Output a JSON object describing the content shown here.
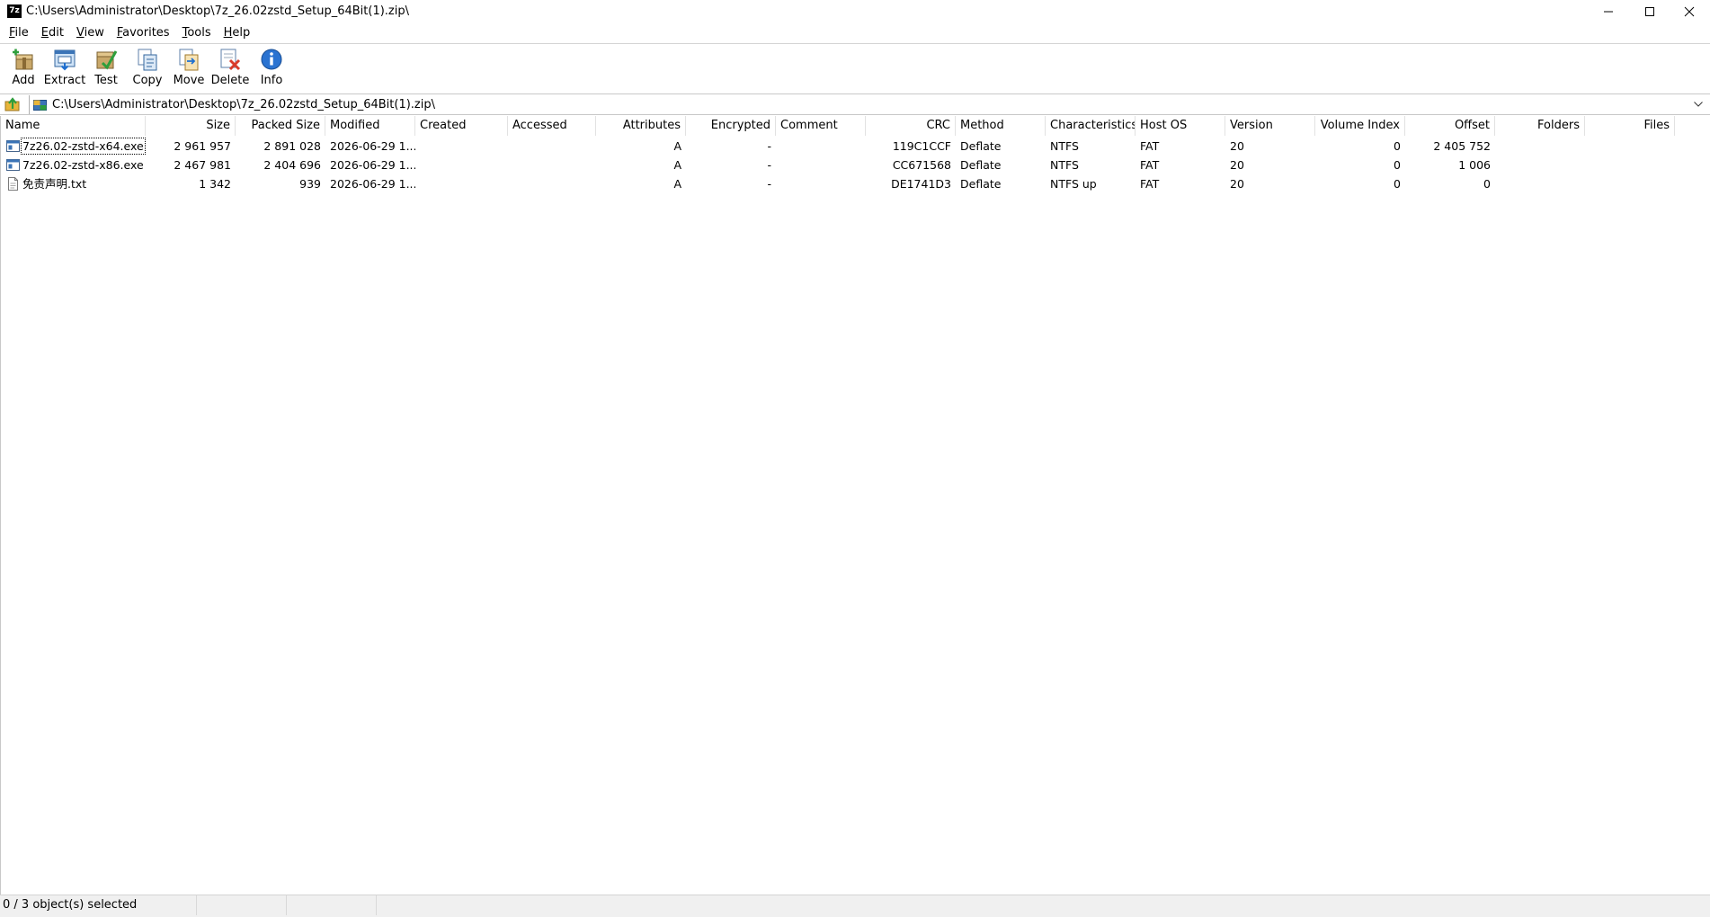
{
  "window": {
    "app_icon_text": "7z",
    "title": "C:\\Users\\Administrator\\Desktop\\7z_26.02zstd_Setup_64Bit(1).zip\\"
  },
  "menu": [
    {
      "label": "File",
      "mnemonic": "F",
      "rest": "ile"
    },
    {
      "label": "Edit",
      "mnemonic": "E",
      "rest": "dit"
    },
    {
      "label": "View",
      "mnemonic": "V",
      "rest": "iew"
    },
    {
      "label": "Favorites",
      "mnemonic": "F",
      "rest": "avorites",
      "prefix": ""
    },
    {
      "label": "Tools",
      "mnemonic": "T",
      "rest": "ools"
    },
    {
      "label": "Help",
      "mnemonic": "H",
      "rest": "elp"
    }
  ],
  "toolbar": {
    "add": "Add",
    "extract": "Extract",
    "test": "Test",
    "copy": "Copy",
    "move": "Move",
    "delete": "Delete",
    "info": "Info"
  },
  "address": {
    "path": "C:\\Users\\Administrator\\Desktop\\7z_26.02zstd_Setup_64Bit(1).zip\\"
  },
  "columns": {
    "name": "Name",
    "size": "Size",
    "packed_size": "Packed Size",
    "modified": "Modified",
    "created": "Created",
    "accessed": "Accessed",
    "attributes": "Attributes",
    "encrypted": "Encrypted",
    "comment": "Comment",
    "crc": "CRC",
    "method": "Method",
    "characteristics": "Characteristics",
    "host_os": "Host OS",
    "version": "Version",
    "volume_index": "Volume Index",
    "offset": "Offset",
    "folders": "Folders",
    "files": "Files"
  },
  "files": [
    {
      "name": "7z26.02-zstd-x64.exe",
      "icon": "exe-file-icon",
      "size": "2 961 957",
      "packed_size": "2 891 028",
      "modified": "2026-06-29 1...",
      "created": "",
      "accessed": "",
      "attributes": "A",
      "encrypted": "-",
      "comment": "",
      "crc": "119C1CCF",
      "method": "Deflate",
      "characteristics": "NTFS",
      "host_os": "FAT",
      "version": "20",
      "volume_index": "0",
      "offset": "2 405 752",
      "folders": "",
      "files": ""
    },
    {
      "name": "7z26.02-zstd-x86.exe",
      "icon": "exe-file-icon",
      "size": "2 467 981",
      "packed_size": "2 404 696",
      "modified": "2026-06-29 1...",
      "created": "",
      "accessed": "",
      "attributes": "A",
      "encrypted": "-",
      "comment": "",
      "crc": "CC671568",
      "method": "Deflate",
      "characteristics": "NTFS",
      "host_os": "FAT",
      "version": "20",
      "volume_index": "0",
      "offset": "1 006",
      "folders": "",
      "files": ""
    },
    {
      "name": "免责声明.txt",
      "icon": "text-file-icon",
      "size": "1 342",
      "packed_size": "939",
      "modified": "2026-06-29 1...",
      "created": "",
      "accessed": "",
      "attributes": "A",
      "encrypted": "-",
      "comment": "",
      "crc": "DE1741D3",
      "method": "Deflate",
      "characteristics": "NTFS up",
      "host_os": "FAT",
      "version": "20",
      "volume_index": "0",
      "offset": "0",
      "folders": "",
      "files": ""
    }
  ],
  "status": {
    "selection": "0 / 3 object(s) selected",
    "seg2": "",
    "seg3": "",
    "seg4": ""
  },
  "colors": {
    "accent_blue": "#1e6fd0",
    "delete_red": "#d83b2b",
    "folder_yellow": "#e8b53a"
  }
}
